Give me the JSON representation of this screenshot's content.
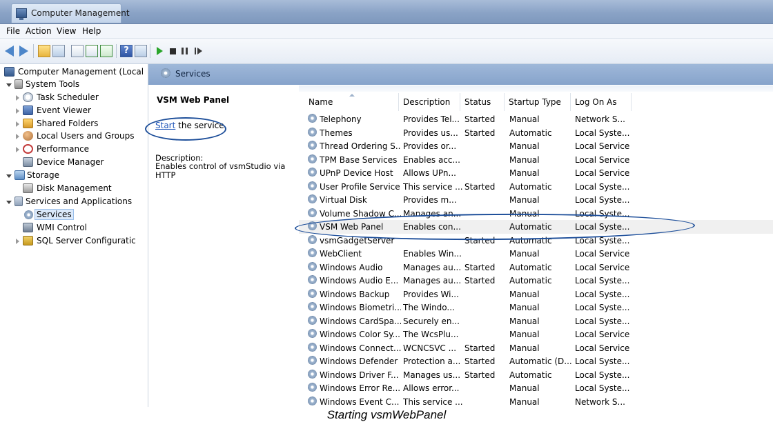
{
  "window": {
    "title": "Computer Management"
  },
  "menu": [
    "File",
    "Action",
    "View",
    "Help"
  ],
  "tree": {
    "root": "Computer Management (Local",
    "items": [
      {
        "label": "System Tools",
        "icon": "tools-icon"
      },
      {
        "label": "Task Scheduler",
        "icon": "clock-icon"
      },
      {
        "label": "Event Viewer",
        "icon": "event-viewer-icon"
      },
      {
        "label": "Shared Folders",
        "icon": "shared-folder-icon"
      },
      {
        "label": "Local Users and Groups",
        "icon": "users-icon"
      },
      {
        "label": "Performance",
        "icon": "performance-icon"
      },
      {
        "label": "Device Manager",
        "icon": "device-manager-icon"
      },
      {
        "label": "Storage",
        "icon": "storage-icon"
      },
      {
        "label": "Disk Management",
        "icon": "disk-icon"
      },
      {
        "label": "Services and Applications",
        "icon": "services-apps-icon"
      },
      {
        "label": "Services",
        "icon": "gear-icon"
      },
      {
        "label": "WMI Control",
        "icon": "wmi-icon"
      },
      {
        "label": "SQL Server Configuratic",
        "icon": "sql-icon"
      }
    ]
  },
  "panel": {
    "header": "Services",
    "selected_service": "VSM Web Panel",
    "start_link": "Start",
    "start_rest": " the service",
    "description_label": "Description:",
    "description": "Enables control of vsmStudio via HTTP"
  },
  "columns": [
    "Name",
    "Description",
    "Status",
    "Startup Type",
    "Log On As"
  ],
  "services": [
    [
      "Telephony",
      "Provides Tel...",
      "Started",
      "Manual",
      "Network S..."
    ],
    [
      "Themes",
      "Provides us...",
      "Started",
      "Automatic",
      "Local Syste..."
    ],
    [
      "Thread Ordering S...",
      "Provides or...",
      "",
      "Manual",
      "Local Service"
    ],
    [
      "TPM Base Services",
      "Enables acc...",
      "",
      "Manual",
      "Local Service"
    ],
    [
      "UPnP Device Host",
      "Allows UPn...",
      "",
      "Manual",
      "Local Service"
    ],
    [
      "User Profile Service",
      "This service ...",
      "Started",
      "Automatic",
      "Local Syste..."
    ],
    [
      "Virtual Disk",
      "Provides m...",
      "",
      "Manual",
      "Local Syste..."
    ],
    [
      "Volume Shadow C...",
      "Manages an...",
      "",
      "Manual",
      "Local Syste..."
    ],
    [
      "VSM Web Panel",
      "Enables con...",
      "",
      "Automatic",
      "Local Syste..."
    ],
    [
      "vsmGadgetServer",
      "",
      "Started",
      "Automatic",
      "Local Syste..."
    ],
    [
      "WebClient",
      "Enables Win...",
      "",
      "Manual",
      "Local Service"
    ],
    [
      "Windows Audio",
      "Manages au...",
      "Started",
      "Automatic",
      "Local Service"
    ],
    [
      "Windows Audio E...",
      "Manages au...",
      "Started",
      "Automatic",
      "Local Syste..."
    ],
    [
      "Windows Backup",
      "Provides Wi...",
      "",
      "Manual",
      "Local Syste..."
    ],
    [
      "Windows Biometri...",
      "The Windo...",
      "",
      "Manual",
      "Local Syste..."
    ],
    [
      "Windows CardSpa...",
      "Securely en...",
      "",
      "Manual",
      "Local Syste..."
    ],
    [
      "Windows Color Sy...",
      "The WcsPlu...",
      "",
      "Manual",
      "Local Service"
    ],
    [
      "Windows Connect...",
      "WCNCSVC ...",
      "Started",
      "Manual",
      "Local Service"
    ],
    [
      "Windows Defender",
      "Protection a...",
      "Started",
      "Automatic (D...",
      "Local Syste..."
    ],
    [
      "Windows Driver F...",
      "Manages us...",
      "Started",
      "Automatic",
      "Local Syste..."
    ],
    [
      "Windows Error Re...",
      "Allows error...",
      "",
      "Manual",
      "Local Syste..."
    ],
    [
      "Windows Event C...",
      "This service ...",
      "",
      "Manual",
      "Network S..."
    ]
  ],
  "caption": "Starting vsmWebPanel"
}
